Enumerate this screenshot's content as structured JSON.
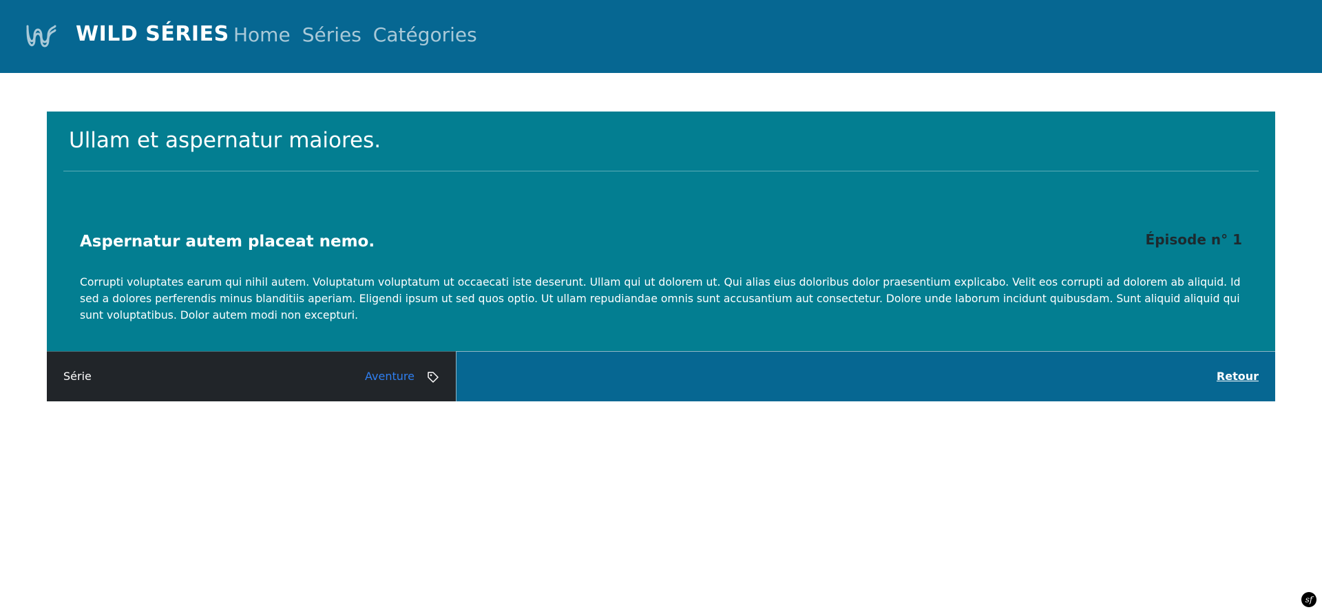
{
  "navbar": {
    "brand_name": "WILD SÉRIES",
    "links": [
      {
        "label": "Home"
      },
      {
        "label": "Séries"
      },
      {
        "label": "Catégories"
      }
    ]
  },
  "card": {
    "header_title": "Ullam et aspernatur maiores.",
    "episode": {
      "title": "Aspernatur autem placeat nemo.",
      "number": "Épisode n° 1",
      "synopsis": "Corrupti voluptates earum qui nihil autem. Voluptatum voluptatum ut occaecati iste deserunt. Ullam qui ut dolorem ut. Qui alias eius doloribus dolor praesentium explicabo. Velit eos corrupti ad dolorem ab aliquid. Id sed a dolores perferendis minus blanditiis aperiam. Eligendi ipsum ut sed quos optio. Ut ullam repudiandae omnis sunt accusantium aut consectetur. Dolore unde laborum incidunt quibusdam. Sunt aliquid aliquid qui sunt voluptatibus. Dolor autem modi non excepturi."
    },
    "footer": {
      "serie_label": "Série",
      "category_label": "Aventure",
      "back_label": "Retour"
    }
  },
  "badge": {
    "text": "sf"
  },
  "colors": {
    "navbar_bg": "#066792",
    "card_bg": "#037e91",
    "footer_dark": "#212529",
    "link_blue": "#2f7ff0"
  }
}
